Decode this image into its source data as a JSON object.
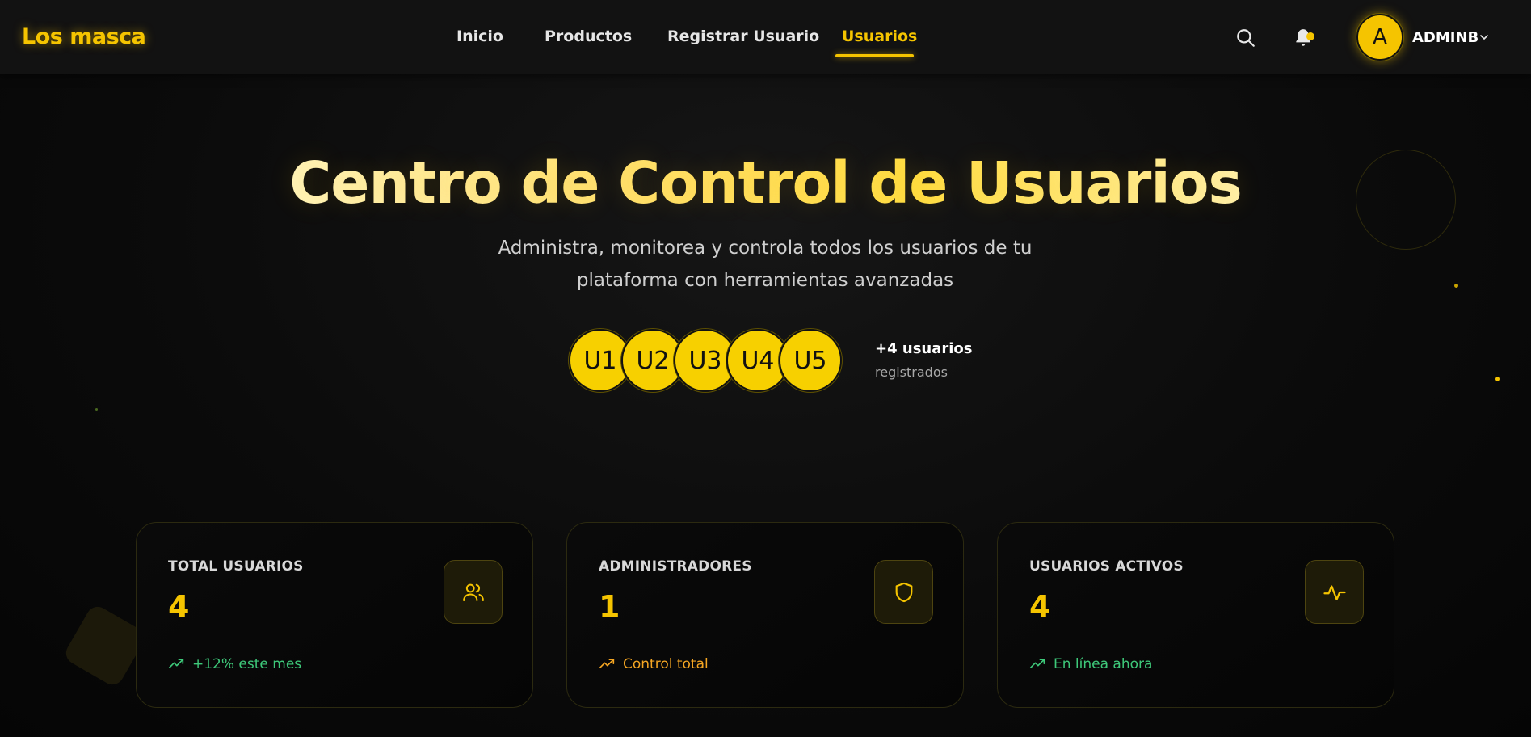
{
  "brand": "Los masca",
  "nav": {
    "items": [
      {
        "label": "Inicio"
      },
      {
        "label": "Productos"
      },
      {
        "label": "Registrar Usuario"
      },
      {
        "label": "Usuarios"
      }
    ],
    "active": "Usuarios"
  },
  "user": {
    "initial": "A",
    "name": "ADMINB"
  },
  "hero": {
    "title": "Centro de Control de Usuarios",
    "subtitle": "Administra, monitorea y controla todos los usuarios de tu plataforma con herramientas avanzadas",
    "avatars": [
      "U1",
      "U2",
      "U3",
      "U4",
      "U5"
    ],
    "extra_count": "+4 usuarios",
    "extra_label": "registrados"
  },
  "stats": [
    {
      "label": "TOTAL USUARIOS",
      "value": "4",
      "icon": "users-icon",
      "trend": "+12% este mes",
      "trend_color": "#3ec97a"
    },
    {
      "label": "ADMINISTRADORES",
      "value": "1",
      "icon": "shield-icon",
      "trend": "Control total",
      "trend_color": "#f5a623"
    },
    {
      "label": "USUARIOS ACTIVOS",
      "value": "4",
      "icon": "activity-icon",
      "trend": "En línea ahora",
      "trend_color": "#3ec97a"
    }
  ],
  "colors": {
    "accent": "#f5c400",
    "background": "#0b0b0b",
    "navbar": "#121212",
    "positive": "#3ec97a",
    "warning": "#f5a623"
  }
}
